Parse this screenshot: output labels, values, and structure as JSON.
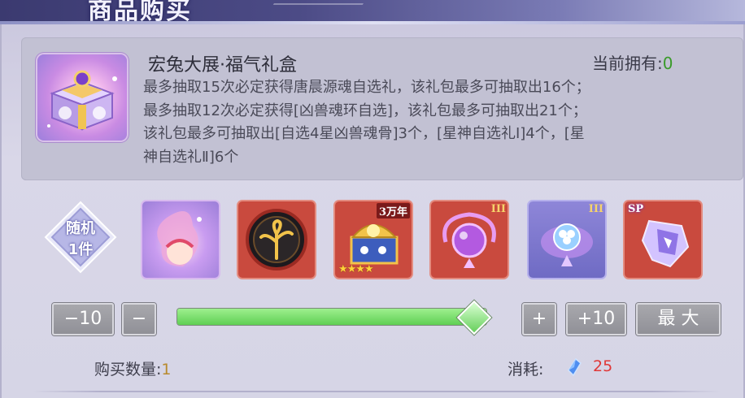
{
  "header": {
    "title": "商品购买"
  },
  "item": {
    "name": "宏兔大展·福气礼盒",
    "owned_label": "当前拥有:",
    "owned_value": "0",
    "description_lines": [
      "最多抽取15次必定获得唐晨源魂自选礼，该礼包最多可抽取出16个；",
      "最多抽取12次必定获得[凶兽魂环自选]，该礼包最多可抽取出21个；",
      "该礼包最多可抽取出[自选4星凶兽魂骨]3个，[星神自选礼Ⅰ]4个，[星",
      "神自选礼Ⅱ]6个"
    ]
  },
  "random": {
    "line1": "随机",
    "line2": "1件"
  },
  "rewards": [
    {
      "icon": "pink-orb-spirit-icon",
      "tag": ""
    },
    {
      "icon": "golden-tree-emblem-icon",
      "tag": ""
    },
    {
      "icon": "golden-beast-chest-icon",
      "tag": "3万年",
      "stars": "★★★★"
    },
    {
      "icon": "purple-orb-relic-icon",
      "tag": "III"
    },
    {
      "icon": "clover-crystal-relic-icon",
      "tag": "III"
    },
    {
      "icon": "crystal-shard-relic-icon",
      "tag": "SP"
    }
  ],
  "controls": {
    "minus10": "−10",
    "minus": "−",
    "plus": "+",
    "plus10": "+10",
    "max": "最 大",
    "slider_fraction": 1.0
  },
  "purchase": {
    "qty_label": "购买数量:",
    "qty_value": "1",
    "cost_label": "消耗:",
    "cost_icon": "blue-crystal-gem-icon",
    "cost_value": "25"
  },
  "colors": {
    "slider_green": "#6fd46a",
    "owned_green": "#3a9b2a",
    "cost_red": "#e03838",
    "qty_gold": "#b88a2e"
  }
}
